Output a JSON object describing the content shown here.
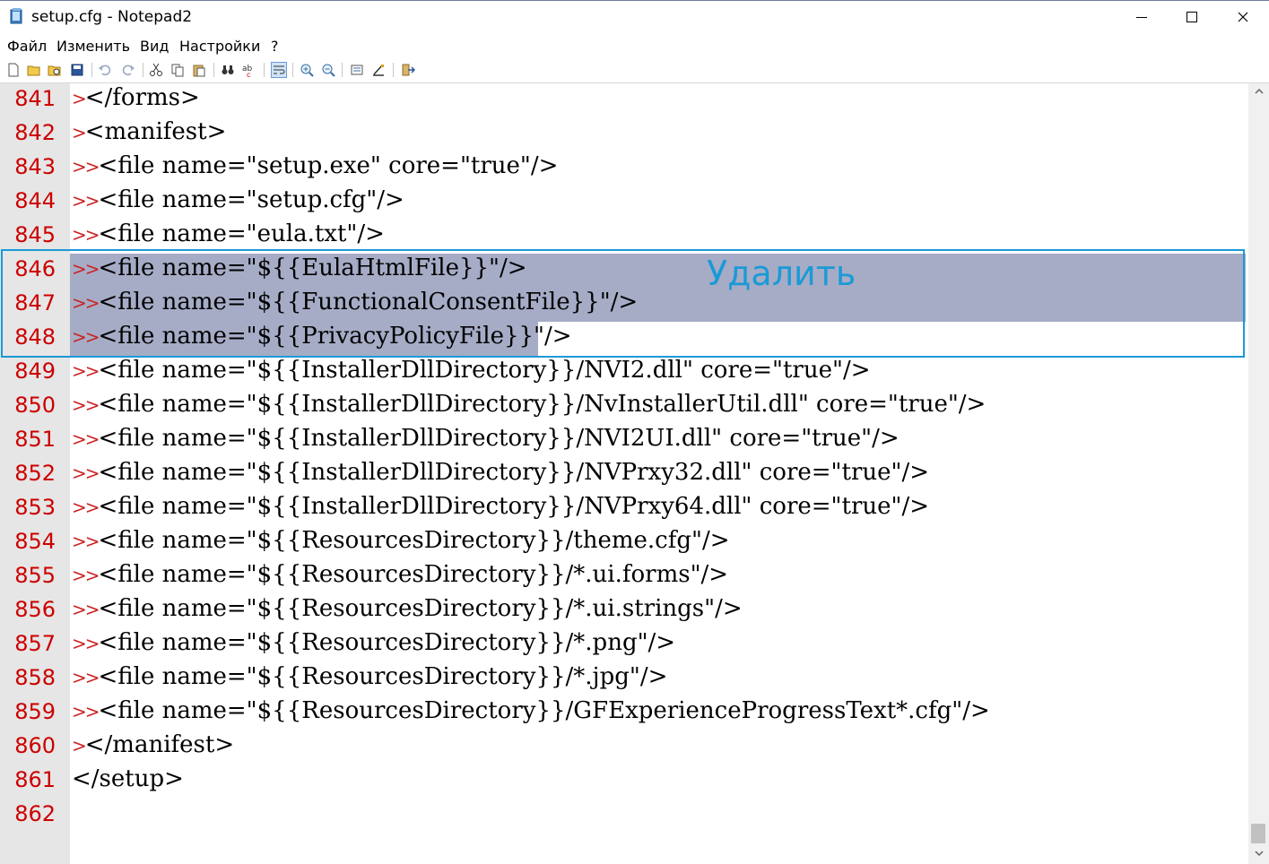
{
  "window": {
    "title": "setup.cfg - Notepad2",
    "minimize_label": "",
    "maximize_label": "",
    "close_label": ""
  },
  "menu": {
    "items": [
      "Файл",
      "Изменить",
      "Вид",
      "Настройки",
      "?"
    ]
  },
  "toolbar": {
    "icons": [
      "new-file-icon",
      "open-file-icon",
      "browse-icon",
      "save-icon",
      "undo-icon",
      "redo-icon",
      "cut-icon",
      "copy-icon",
      "paste-icon",
      "find-icon",
      "replace-icon",
      "word-wrap-icon",
      "zoom-in-icon",
      "zoom-out-icon",
      "scheme-icon",
      "customize-icon",
      "exit-icon"
    ]
  },
  "editor": {
    "lines": [
      {
        "num": "841",
        "indent": 1,
        "text": "</forms>"
      },
      {
        "num": "842",
        "indent": 1,
        "text": "<manifest>"
      },
      {
        "num": "843",
        "indent": 2,
        "text": "<file name=\"setup.exe\" core=\"true\"/>"
      },
      {
        "num": "844",
        "indent": 2,
        "text": "<file name=\"setup.cfg\"/>"
      },
      {
        "num": "845",
        "indent": 2,
        "text": "<file name=\"eula.txt\"/>"
      },
      {
        "num": "846",
        "indent": 2,
        "text": "<file name=\"${{EulaHtmlFile}}\"/>",
        "selected": "full"
      },
      {
        "num": "847",
        "indent": 2,
        "text": "<file name=\"${{FunctionalConsentFile}}\"/>",
        "selected": "full"
      },
      {
        "num": "848",
        "indent": 2,
        "text": "<file name=\"${{PrivacyPolicyFile}}\"/>",
        "selected": "partial"
      },
      {
        "num": "849",
        "indent": 2,
        "text": "<file name=\"${{InstallerDllDirectory}}/NVI2.dll\" core=\"true\"/>"
      },
      {
        "num": "850",
        "indent": 2,
        "text": "<file name=\"${{InstallerDllDirectory}}/NvInstallerUtil.dll\" core=\"true\"/>"
      },
      {
        "num": "851",
        "indent": 2,
        "text": "<file name=\"${{InstallerDllDirectory}}/NVI2UI.dll\" core=\"true\"/>"
      },
      {
        "num": "852",
        "indent": 2,
        "text": "<file name=\"${{InstallerDllDirectory}}/NVPrxy32.dll\" core=\"true\"/>"
      },
      {
        "num": "853",
        "indent": 2,
        "text": "<file name=\"${{InstallerDllDirectory}}/NVPrxy64.dll\" core=\"true\"/>"
      },
      {
        "num": "854",
        "indent": 2,
        "text": "<file name=\"${{ResourcesDirectory}}/theme.cfg\"/>"
      },
      {
        "num": "855",
        "indent": 2,
        "text": "<file name=\"${{ResourcesDirectory}}/*.ui.forms\"/>"
      },
      {
        "num": "856",
        "indent": 2,
        "text": "<file name=\"${{ResourcesDirectory}}/*.ui.strings\"/>"
      },
      {
        "num": "857",
        "indent": 2,
        "text": "<file name=\"${{ResourcesDirectory}}/*.png\"/>"
      },
      {
        "num": "858",
        "indent": 2,
        "text": "<file name=\"${{ResourcesDirectory}}/*.jpg\"/>"
      },
      {
        "num": "859",
        "indent": 2,
        "text": "<file name=\"${{ResourcesDirectory}}/GFExperienceProgressText*.cfg\"/>"
      },
      {
        "num": "860",
        "indent": 1,
        "text": "</manifest>"
      },
      {
        "num": "861",
        "indent": 0,
        "text": "</setup>"
      },
      {
        "num": "862",
        "indent": 0,
        "text": ""
      }
    ],
    "annotation": "Удалить"
  },
  "colors": {
    "line_number": "#cc0000",
    "selection": "#a6acc6",
    "annotation": "#1a9ad6",
    "gutter": "#e6e6e6"
  }
}
